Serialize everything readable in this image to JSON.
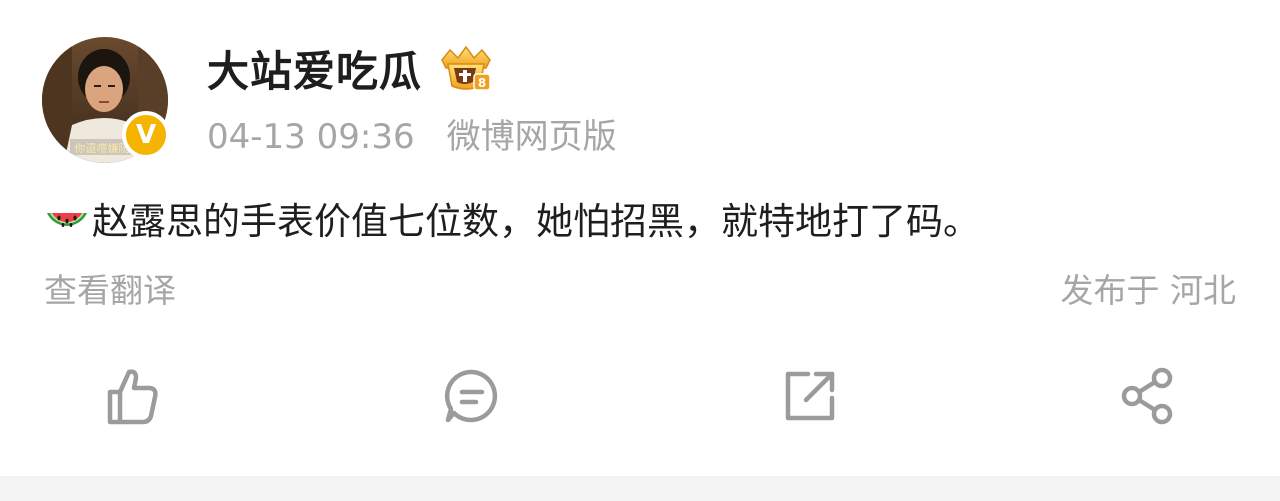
{
  "post": {
    "author": {
      "name": "大站爱吃瓜",
      "avatar_caption": "你還嚐嫌阮",
      "verified_badge": "V",
      "badge_icon": "crown-icon",
      "badge_level": "8"
    },
    "timestamp": "04-13 09:36",
    "source": "微博网页版",
    "content_icon": "watermelon-icon",
    "content": "赵露思的手表价值七位数，她怕招黑，就特地打了码。",
    "translate_label": "查看翻译",
    "location": "发布于 河北"
  },
  "actions": [
    {
      "name": "like",
      "icon": "thumbs-up-icon"
    },
    {
      "name": "comment",
      "icon": "comment-icon"
    },
    {
      "name": "repost",
      "icon": "repost-icon"
    },
    {
      "name": "share",
      "icon": "share-icon"
    }
  ],
  "colors": {
    "text_primary": "#1e1e1e",
    "text_secondary": "#a6a6a6",
    "verified": "#f5b400",
    "icon_gray": "#9b9b9b"
  }
}
